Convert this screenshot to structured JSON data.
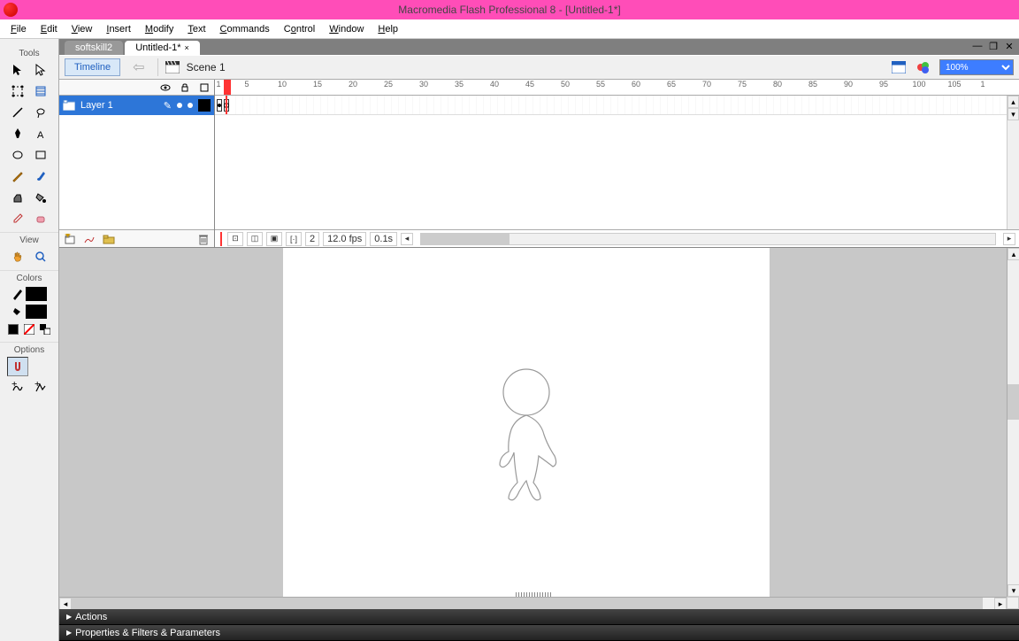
{
  "app": {
    "title": "Macromedia Flash Professional 8 - [Untitled-1*]"
  },
  "menu": [
    "File",
    "Edit",
    "View",
    "Insert",
    "Modify",
    "Text",
    "Commands",
    "Control",
    "Window",
    "Help"
  ],
  "toolbar": {
    "sections": [
      "Tools",
      "View",
      "Colors",
      "Options"
    ]
  },
  "tabs": [
    {
      "label": "softskill2",
      "active": false
    },
    {
      "label": "Untitled-1*",
      "active": true
    }
  ],
  "scene": {
    "timeline_btn": "Timeline",
    "scene_label": "Scene 1",
    "zoom": "100%"
  },
  "ruler_ticks": [
    "1",
    "5",
    "10",
    "15",
    "20",
    "25",
    "30",
    "35",
    "40",
    "45",
    "50",
    "55",
    "60",
    "65",
    "70",
    "75",
    "80",
    "85",
    "90",
    "95",
    "100",
    "105",
    "1"
  ],
  "layer": {
    "name": "Layer 1"
  },
  "timeline_status": {
    "frame": "2",
    "fps": "12.0 fps",
    "time": "0.1s"
  },
  "bottom_panels": [
    "Actions",
    "Properties & Filters & Parameters"
  ]
}
